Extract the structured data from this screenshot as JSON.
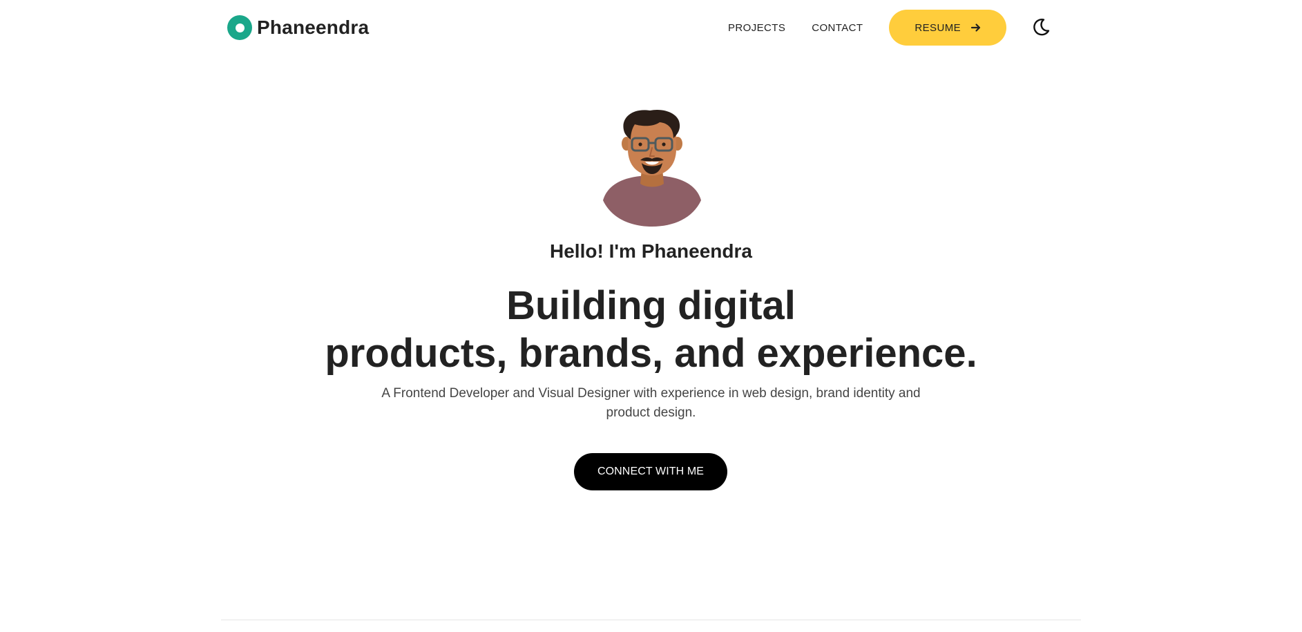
{
  "header": {
    "brand_name": "Phaneendra",
    "nav": {
      "projects": "PROJECTS",
      "contact": "CONTACT"
    },
    "resume_label": "RESUME",
    "icons": {
      "logo": "circle-logo-icon",
      "resume_arrow": "arrow-right-icon",
      "theme_toggle": "moon-icon"
    }
  },
  "hero": {
    "greeting": "Hello! I'm Phaneendra",
    "headline_line1": "Building digital",
    "headline_line2": "products, brands, and experience.",
    "subtitle": "A Frontend Developer and Visual Designer with experience in web design, brand identity and product design.",
    "cta_label": "CONNECT WITH ME"
  },
  "colors": {
    "accent_yellow": "#ffcd3c",
    "logo_green": "#1aa78a",
    "cta_black": "#000000",
    "text_dark": "#222222"
  }
}
